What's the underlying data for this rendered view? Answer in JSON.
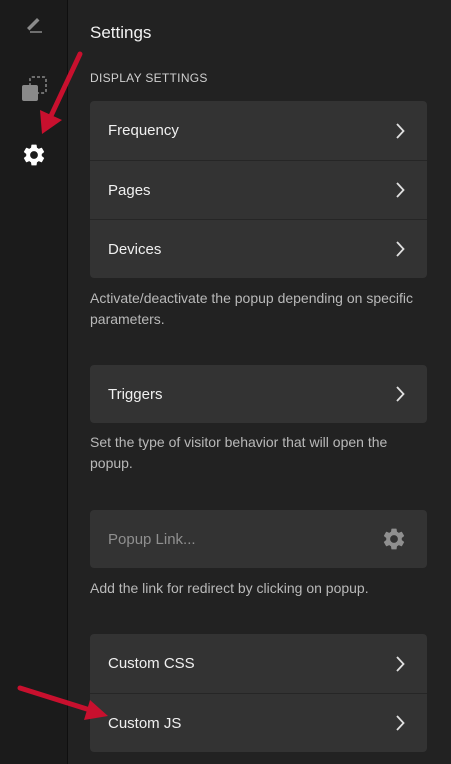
{
  "rail": {
    "items": [
      {
        "icon": "pencil-icon"
      },
      {
        "icon": "layers-icon"
      },
      {
        "icon": "gear-icon",
        "active": true
      }
    ]
  },
  "header": {
    "title": "Settings"
  },
  "display_settings": {
    "label": "DISPLAY SETTINGS",
    "items": [
      {
        "label": "Frequency"
      },
      {
        "label": "Pages"
      },
      {
        "label": "Devices"
      }
    ],
    "help": "Activate/deactivate the popup depending on specific parameters."
  },
  "triggers": {
    "label": "Triggers",
    "help": "Set the type of visitor behavior that will open the popup."
  },
  "popup_link": {
    "placeholder": "Popup Link...",
    "value": "",
    "help": "Add the link for redirect by clicking on popup."
  },
  "custom": {
    "items": [
      {
        "label": "Custom CSS"
      },
      {
        "label": "Custom JS"
      }
    ]
  },
  "colors": {
    "background": "#222222",
    "rail": "#1b1b1b",
    "card": "#333333",
    "annotation_arrow": "#c8102e"
  }
}
